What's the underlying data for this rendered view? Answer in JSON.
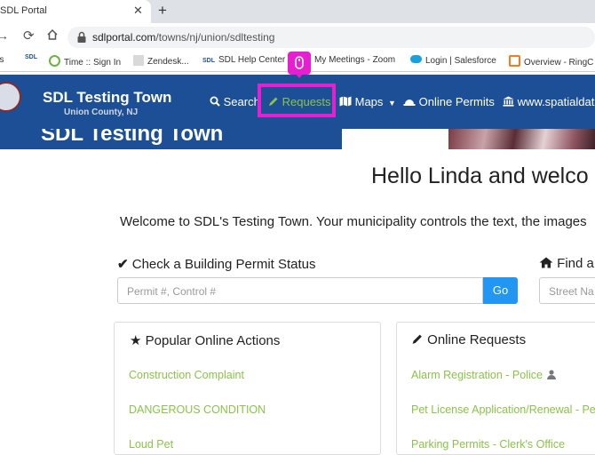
{
  "browser": {
    "tab_title": "SDL Portal",
    "tab_close": "✕",
    "new_tab": "+",
    "url_domain": "sdlportal.com",
    "url_path": "/towns/nj/union/sdltesting",
    "bookmarks": [
      {
        "label": "ps"
      },
      {
        "label": "SDL"
      },
      {
        "label": "Time :: Sign In"
      },
      {
        "label": "Zendesk..."
      },
      {
        "label": "SDL Help Center"
      },
      {
        "label": "My Meetings - Zoom"
      },
      {
        "label": "Login | Salesforce"
      },
      {
        "label": "Overview - RingC"
      }
    ]
  },
  "header": {
    "town_name": "SDL Testing Town",
    "county": "Union County, NJ",
    "menu": {
      "search": "Search",
      "requests": "Requests",
      "maps": "Maps",
      "online_permits": "Online Permits",
      "website": "www.spatialdata"
    }
  },
  "hero": {
    "text": "SDL Testing Town"
  },
  "main": {
    "greeting": "Hello Linda and welco",
    "welcome": "Welcome to SDL's Testing Town. Your municipality controls the text, the images",
    "permit_status": {
      "title": "Check a Building Permit Status",
      "placeholder": "Permit #, Control #",
      "go": "Go"
    },
    "find_address": {
      "title": "Find a",
      "placeholder": "Street Na"
    },
    "popular_actions": {
      "title": "Popular Online Actions",
      "links": [
        "Construction Complaint",
        "DANGEROUS CONDITION",
        "Loud Pet"
      ]
    },
    "online_requests": {
      "title": "Online Requests",
      "links": [
        "Alarm Registration - Police",
        "Pet License Application/Renewal - Pet",
        "Parking Permits - Clerk's Office"
      ]
    }
  },
  "colors": {
    "accent": "#e620d0",
    "header_blue": "#1d4f96",
    "link_green": "#8bc34a",
    "button_blue": "#2196f3"
  }
}
